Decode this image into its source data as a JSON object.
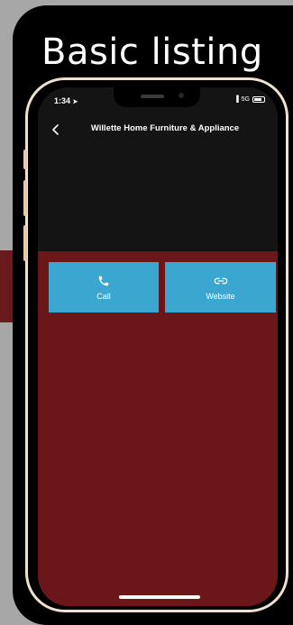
{
  "slide": {
    "heading": "Basic listing"
  },
  "status_bar": {
    "time": "1:34",
    "network": "5G"
  },
  "nav": {
    "title": "Willette Home Furniture & Appliance",
    "back_icon": "chevron-left-icon"
  },
  "actions": [
    {
      "label": "Call",
      "icon": "phone-icon"
    },
    {
      "label": "Website",
      "icon": "link-icon"
    }
  ],
  "colors": {
    "accent": "#3ba6cf",
    "background": "#6b1719",
    "header": "#141414"
  }
}
